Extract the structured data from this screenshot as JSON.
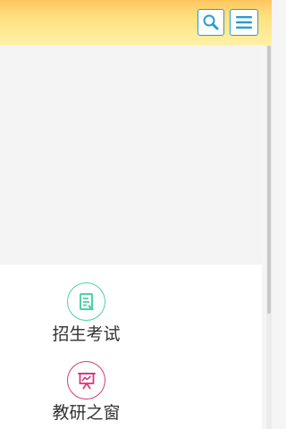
{
  "header": {
    "colors": {
      "gradient_top": "#ffc55e",
      "gradient_bottom": "#fff1a8",
      "button_border": "#2a9ad6"
    },
    "search_icon": "search-icon",
    "menu_icon": "hamburger-menu-icon"
  },
  "nav": {
    "items": [
      {
        "label": "招生考试",
        "icon": "exam-document-icon",
        "color": "#4fd0a6"
      },
      {
        "label": "教研之窗",
        "icon": "presentation-board-icon",
        "color": "#d63a7a"
      }
    ]
  }
}
